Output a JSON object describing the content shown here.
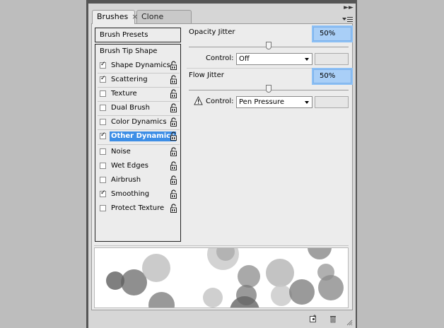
{
  "tabs": [
    {
      "label": "Brushes",
      "close": "×"
    },
    {
      "label": "Clone Source"
    }
  ],
  "collapse_glyph": "►►",
  "left_panel": {
    "presets_label": "Brush Presets",
    "tip_shape_label": "Brush Tip Shape",
    "group1": [
      {
        "label": "Shape Dynamics",
        "checked": true,
        "selected": false
      },
      {
        "label": "Scattering",
        "checked": true,
        "selected": false
      },
      {
        "label": "Texture",
        "checked": false,
        "selected": false
      },
      {
        "label": "Dual Brush",
        "checked": false,
        "selected": false
      },
      {
        "label": "Color Dynamics",
        "checked": false,
        "selected": false
      },
      {
        "label": "Other Dynamics",
        "checked": true,
        "selected": true
      }
    ],
    "group2": [
      {
        "label": "Noise",
        "checked": false
      },
      {
        "label": "Wet Edges",
        "checked": false
      },
      {
        "label": "Airbrush",
        "checked": false
      },
      {
        "label": "Smoothing",
        "checked": true
      },
      {
        "label": "Protect Texture",
        "checked": false
      }
    ]
  },
  "opacity": {
    "title": "Opacity Jitter",
    "value": "50%",
    "slider_fraction": 0.5,
    "control_label": "Control:",
    "control_value": "Off"
  },
  "flow": {
    "title": "Flow Jitter",
    "value": "50%",
    "slider_fraction": 0.5,
    "control_label": "Control:",
    "control_value": "Pen Pressure"
  },
  "colors": {
    "selection": "#3d8ee6",
    "value_field": "#a9cff7",
    "panel_bg": "#ececec"
  },
  "icons": {
    "lock": "lock-icon",
    "warning": "warning-icon",
    "new_brush": "new-brush-icon",
    "delete": "trash-icon",
    "panel_menu": "panel-menu-icon"
  }
}
